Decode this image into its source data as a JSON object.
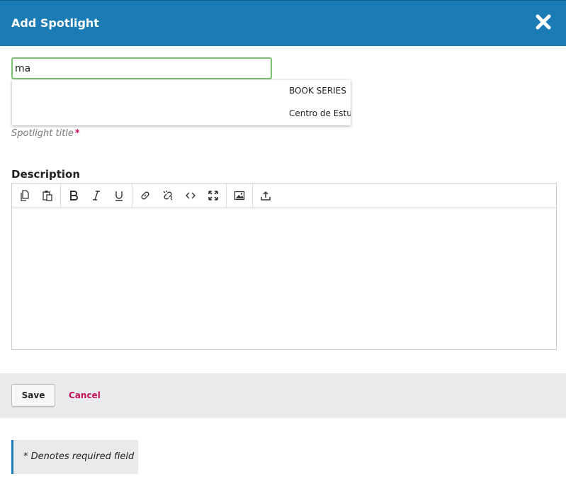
{
  "dialog": {
    "title": "Add Spotlight",
    "close_icon": "close-icon"
  },
  "search": {
    "value": "ma"
  },
  "autocomplete": {
    "options": [
      "BOOK SERIES",
      "Centro de Estuc"
    ]
  },
  "spotlight_title": {
    "label": "Spotlight title",
    "required_marker": "*"
  },
  "description": {
    "label": "Description"
  },
  "toolbar_icons": [
    "copy-icon",
    "paste-icon",
    "bold-icon",
    "italic-icon",
    "underline-icon",
    "link-icon",
    "unlink-icon",
    "code-icon",
    "fullscreen-icon",
    "image-icon",
    "upload-icon"
  ],
  "footer": {
    "save_label": "Save",
    "cancel_label": "Cancel"
  },
  "note": {
    "text": "* Denotes required field"
  },
  "colors": {
    "header": "#1a7bb5",
    "accent": "#c3115c",
    "focus": "#7ac070"
  }
}
